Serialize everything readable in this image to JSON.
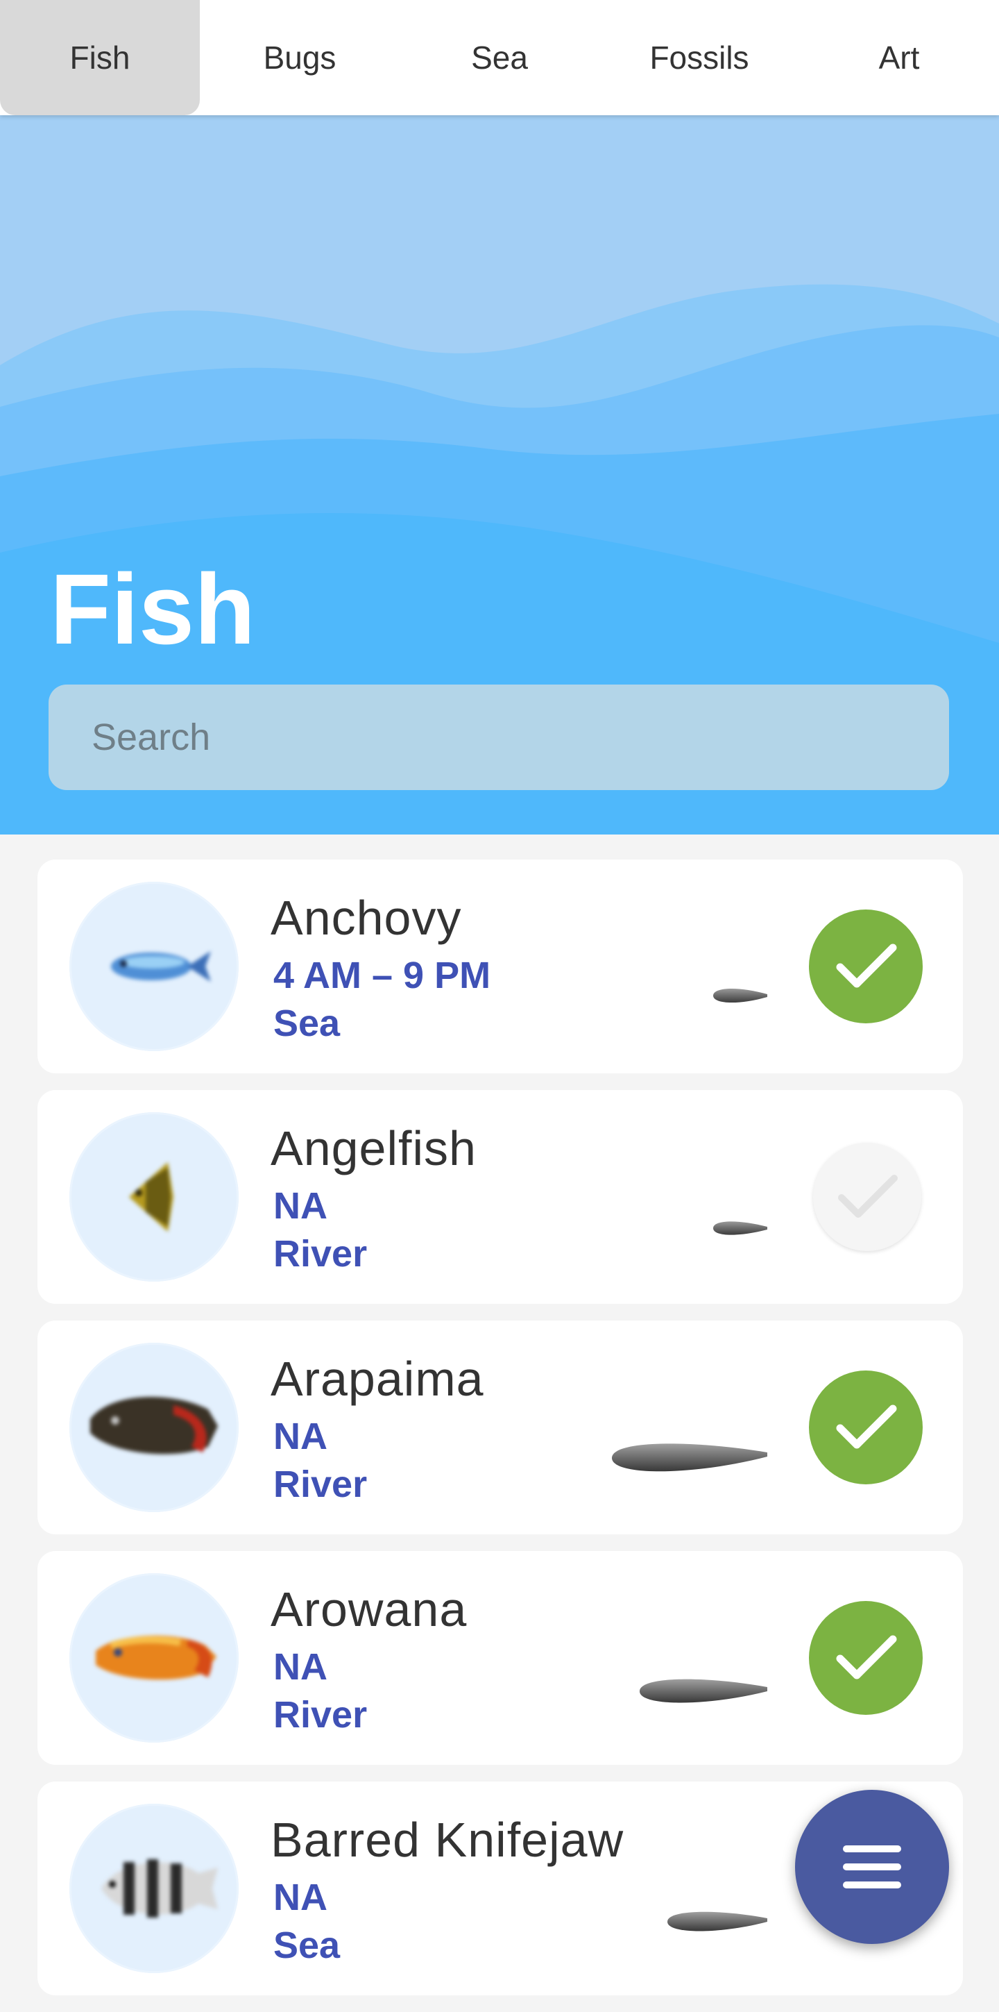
{
  "tabs": [
    {
      "label": "Fish",
      "active": true
    },
    {
      "label": "Bugs",
      "active": false
    },
    {
      "label": "Sea",
      "active": false
    },
    {
      "label": "Fossils",
      "active": false
    },
    {
      "label": "Art",
      "active": false
    }
  ],
  "hero": {
    "title": "Fish"
  },
  "search": {
    "placeholder": "Search",
    "value": ""
  },
  "items": [
    {
      "name": "Anchovy",
      "time": "4 AM – 9 PM",
      "location": "Sea",
      "caught": true,
      "icon": "anchovy-icon",
      "shadow_size": "small"
    },
    {
      "name": "Angelfish",
      "time": "NA",
      "location": "River",
      "caught": false,
      "icon": "angelfish-icon",
      "shadow_size": "small"
    },
    {
      "name": "Arapaima",
      "time": "NA",
      "location": "River",
      "caught": true,
      "icon": "arapaima-icon",
      "shadow_size": "extra-large"
    },
    {
      "name": "Arowana",
      "time": "NA",
      "location": "River",
      "caught": true,
      "icon": "arowana-icon",
      "shadow_size": "large"
    },
    {
      "name": "Barred Knifejaw",
      "time": "NA",
      "location": "Sea",
      "caught": null,
      "icon": "barred-knifejaw-icon",
      "shadow_size": "medium"
    }
  ],
  "fab": {
    "icon": "menu-icon"
  },
  "colors": {
    "tab_active_bg": "#d9d9d9",
    "hero_sky": "#a3cff5",
    "hero_water": "#4fb8fb",
    "detail_text": "#3f51b5",
    "caught_green": "#7cb342",
    "fab": "#4a5aa0"
  }
}
